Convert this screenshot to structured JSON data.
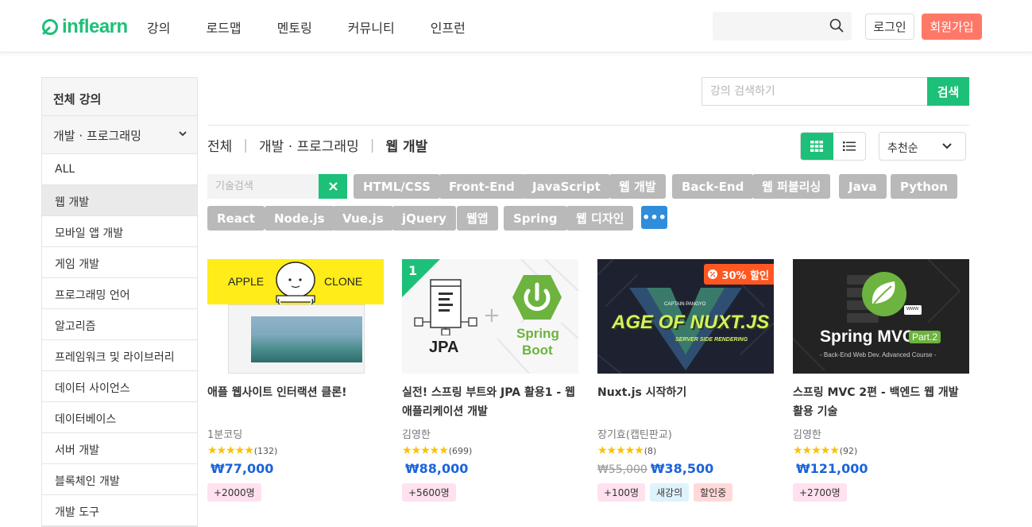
{
  "header": {
    "logo": "inflearn",
    "nav": [
      "강의",
      "로드맵",
      "멘토링",
      "커뮤니티",
      "인프런"
    ],
    "login": "로그인",
    "signup": "회원가입"
  },
  "sidebar": {
    "title": "전체 강의",
    "category": "개발 · 프로그래밍",
    "items": [
      "ALL",
      "웹 개발",
      "모바일 앱 개발",
      "게임 개발",
      "프로그래밍 언어",
      "알고리즘",
      "프레임워크 및 라이브러리",
      "데이터 사이언스",
      "데이터베이스",
      "서버 개발",
      "블록체인 개발",
      "개발 도구"
    ]
  },
  "search": {
    "placeholder": "강의 검색하기",
    "button": "검색"
  },
  "breadcrumb": [
    "전체",
    "개발 · 프로그래밍",
    "웹 개발"
  ],
  "sort": "추천순",
  "tag_search": {
    "placeholder": "기술검색"
  },
  "tags": [
    "HTML/CSS",
    "Front-End",
    "JavaScript",
    "웹 개발",
    "Back-End",
    "웹 퍼블리싱",
    "Java",
    "Python",
    "React",
    "Node.js",
    "Vue.js",
    "jQuery",
    "웹앱",
    "Spring",
    "웹 디자인"
  ],
  "more_tag": "•••",
  "courses": [
    {
      "title": "애플 웹사이트 인터랙션 클론!",
      "instructor": "1분코딩",
      "rating_count": "(132)",
      "price": "₩77,000",
      "old_price": "",
      "badges": [
        "+2000명"
      ],
      "thumb": {
        "left": "APPLE",
        "right": "CLONE"
      }
    },
    {
      "title": "실전! 스프링 부트와 JPA 활용1 - 웹 애플리케이션 개발",
      "instructor": "김영한",
      "rating_count": "(699)",
      "price": "₩88,000",
      "old_price": "",
      "badges": [
        "+5600명"
      ],
      "thumb": {
        "rank": "1",
        "left": "JPA",
        "right1": "Spring",
        "right2": "Boot"
      }
    },
    {
      "title": "Nuxt.js 시작하기",
      "instructor": "장기효(캡틴판교)",
      "rating_count": "(8)",
      "price": "₩38,500",
      "old_price": "₩55,000",
      "badges": [
        "+100명",
        "새강의",
        "할인중"
      ],
      "thumb": {
        "discount": "30% 할인",
        "captain": "CAPTAIN PANGYO",
        "main": "AGE OF NUXT.JS",
        "sub": "SERVER SIDE RENDERING"
      }
    },
    {
      "title": "스프링 MVC 2편 - 백엔드 웹 개발 활용 기술",
      "instructor": "김영한",
      "rating_count": "(92)",
      "price": "₩121,000",
      "old_price": "",
      "badges": [
        "+2700명"
      ],
      "thumb": {
        "www": "www",
        "main": "Spring MVC",
        "part": "Part.2",
        "sub": "- Back-End Web Dev. Advanced Course -"
      }
    }
  ],
  "stars": "★★★★★",
  "colors": {
    "brand": "#1dc078",
    "signup": "#ff7867",
    "price": "#1b64da",
    "tag": "#b9b9b9",
    "more": "#2f8ddb"
  }
}
